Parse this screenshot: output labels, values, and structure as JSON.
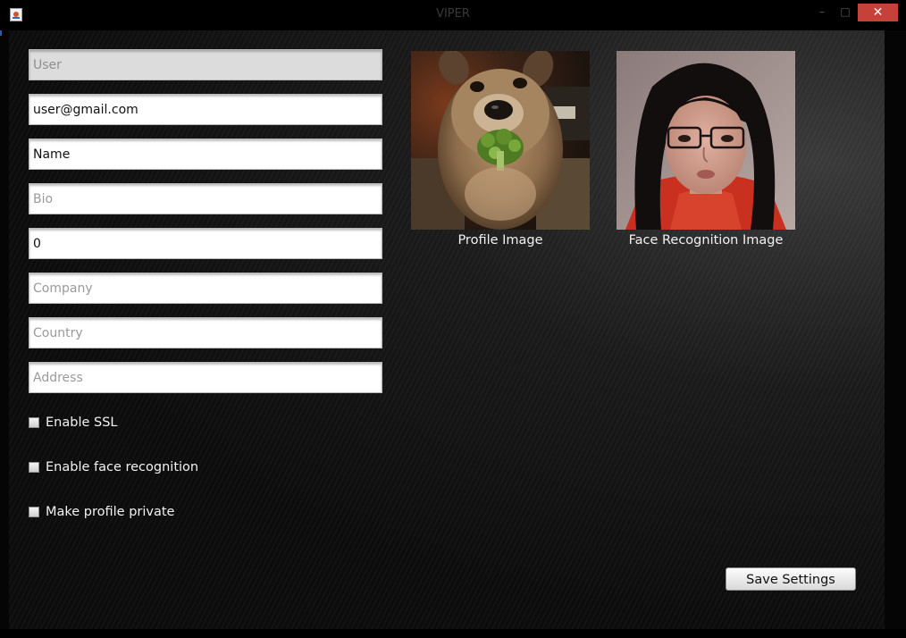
{
  "window": {
    "title": "VIPER",
    "minimize_glyph": "–",
    "maximize_glyph": "□",
    "close_glyph": "✕"
  },
  "form": {
    "user_placeholder": "User",
    "email_value": "user@gmail.com",
    "name_value": "Name",
    "bio_placeholder": "Bio",
    "number_value": "0",
    "company_placeholder": "Company",
    "country_placeholder": "Country",
    "address_placeholder": "Address"
  },
  "options": {
    "ssl_label": "Enable SSL",
    "ssl_checked": false,
    "face_label": "Enable face recognition",
    "face_checked": false,
    "private_label": "Make profile private",
    "private_checked": false
  },
  "images": {
    "profile_caption": "Profile Image",
    "face_caption": "Face Recognition Image"
  },
  "actions": {
    "save_label": "Save Settings"
  },
  "colors": {
    "close_button": "#c7413b",
    "background": "#111111",
    "text": "#f2f2f2"
  }
}
